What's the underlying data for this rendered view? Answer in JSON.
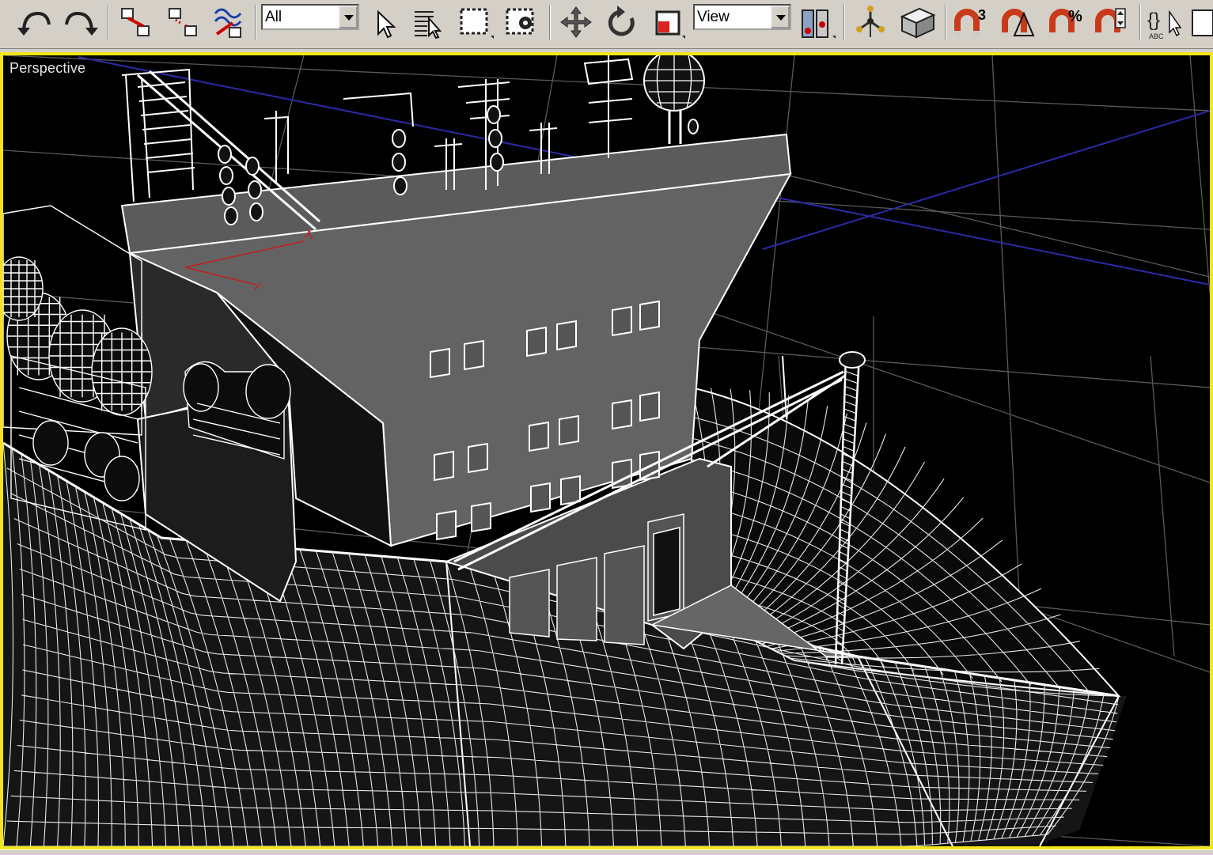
{
  "app": {
    "name": "3D modeling application"
  },
  "toolbar": {
    "selection_filter": {
      "value": "All",
      "options_visible": [
        "All"
      ]
    },
    "reference_coord": {
      "value": "View",
      "options_visible": [
        "View"
      ]
    },
    "snap_angle_label": "3",
    "percent_snap_label": "%",
    "edit_named_label": "ABC",
    "icons": [
      "undo-icon",
      "redo-icon",
      "select-and-link-icon",
      "unlink-selection-icon",
      "bind-to-space-warp-icon",
      "select-object-icon",
      "select-by-name-icon",
      "rectangular-selection-region-icon",
      "window-crossing-icon",
      "select-and-move-icon",
      "select-and-rotate-icon",
      "select-and-scale-icon",
      "use-pivot-center-icon",
      "select-and-manipulate-icon",
      "keyboard-shortcut-override-icon",
      "snaps-toggle-icon",
      "angle-snap-icon",
      "percent-snap-icon",
      "spinner-snap-icon",
      "edit-named-selection-icon",
      "mirror-icon"
    ]
  },
  "viewport": {
    "label": "Perspective",
    "border_color": "#f2e51c",
    "background": "#000000",
    "grid_color": "#5a5a5a",
    "axis_color": "#2a2aa8",
    "wire_color": "#ffffff",
    "surface_color": "#686868"
  }
}
